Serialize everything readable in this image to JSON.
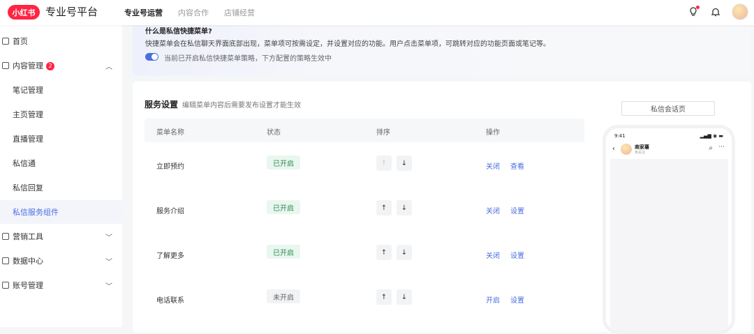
{
  "header": {
    "logo": "小红书",
    "platform": "专业号平台",
    "nav": [
      "专业号运营",
      "内容合作",
      "店铺经营"
    ],
    "icons": [
      "lightbulb-icon",
      "bell-icon",
      "avatar"
    ]
  },
  "sidebar": {
    "items": [
      {
        "label": "首页",
        "icon": "grid-icon"
      },
      {
        "label": "内容管理",
        "icon": "document-icon",
        "badge": "2",
        "expanded": true
      },
      {
        "label": "笔记管理"
      },
      {
        "label": "主页管理"
      },
      {
        "label": "直播管理"
      },
      {
        "label": "私信通"
      },
      {
        "label": "私信回复"
      },
      {
        "label": "私信服务组件",
        "selected": true
      },
      {
        "label": "营销工具",
        "icon": "calendar-icon"
      },
      {
        "label": "数据中心",
        "icon": "chart-icon"
      },
      {
        "label": "账号管理",
        "icon": "settings-icon"
      }
    ]
  },
  "notice": {
    "title": "什么是私信快捷菜单?",
    "desc": "快捷菜单会在私信聊天界面底部出现，菜单项可按需设定，并设置对应的功能。用户点击菜单项，可跳转对应的功能页面或笔记等。",
    "toggle_text": "当前已开启私信快捷菜单策略，下方配置的策略生效中"
  },
  "panel": {
    "title": "服务设置",
    "subtitle": "编辑菜单内容后需要发布设置才能生效",
    "columns": [
      "菜单名称",
      "状态",
      "排序",
      "操作"
    ],
    "rows": [
      {
        "name": "立即预约",
        "status": "已开启",
        "on": true,
        "up_disabled": true,
        "action1": "关闭",
        "action2": "查看"
      },
      {
        "name": "服务介绍",
        "status": "已开启",
        "on": true,
        "up_disabled": false,
        "action1": "关闭",
        "action2": "设置"
      },
      {
        "name": "了解更多",
        "status": "已开启",
        "on": true,
        "up_disabled": false,
        "action1": "关闭",
        "action2": "设置"
      },
      {
        "name": "电话联系",
        "status": "未开启",
        "on": false,
        "up_disabled": false,
        "action1": "开启",
        "action2": "设置"
      }
    ],
    "up_arrow": "↑",
    "down_arrow": "↓"
  },
  "preview": {
    "label": "私信会话页",
    "time": "9:41",
    "merchant": "商家薯",
    "merchant_sub": "未关注"
  },
  "colors": {
    "brand": "#ff2442",
    "accent": "#4a6ee0",
    "status_on": "#2f8a55"
  }
}
